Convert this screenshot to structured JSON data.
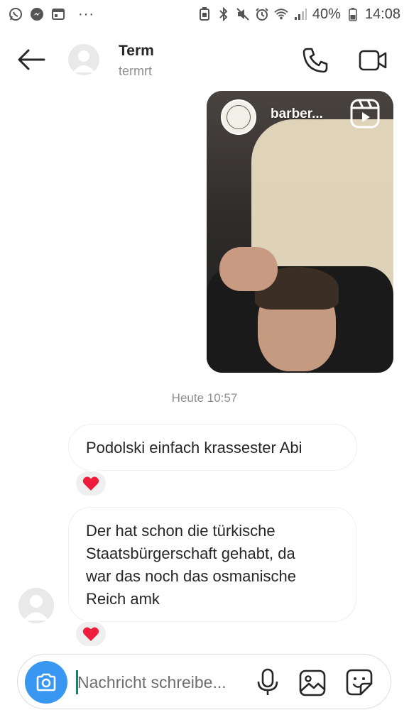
{
  "status_bar": {
    "battery_percent": "40%",
    "time": "14:08",
    "overflow": "···",
    "icons": [
      "whatsapp-icon",
      "messenger-icon",
      "calendar-icon",
      "battery-saver-icon",
      "bluetooth-icon",
      "mute-icon",
      "alarm-icon",
      "wifi-icon",
      "signal-icon",
      "battery-icon"
    ]
  },
  "header": {
    "name": "Term",
    "username": "termrt",
    "icons": [
      "back-arrow-icon",
      "phone-icon",
      "video-call-icon"
    ]
  },
  "shared_reel": {
    "account": "barber..."
  },
  "conversation": {
    "timestamp": "Heute 10:57",
    "messages": [
      {
        "lines": [
          "Podolski einfach krassester Abi"
        ],
        "reaction": "❤️"
      },
      {
        "lines": [
          "Der hat schon die türkische",
          "Staatsbürgerschaft gehabt, da",
          "war das noch das osmanische",
          "Reich amk"
        ],
        "reaction": "❤️"
      }
    ]
  },
  "composer": {
    "placeholder": "Nachricht schreibe...",
    "icons": [
      "camera-icon",
      "microphone-icon",
      "gallery-icon",
      "sticker-icon"
    ]
  },
  "colors": {
    "accent": "#3897f0",
    "heart": "#ed1c3b",
    "secondary_text": "#8e8e8e",
    "bubble_border": "#efefef"
  }
}
